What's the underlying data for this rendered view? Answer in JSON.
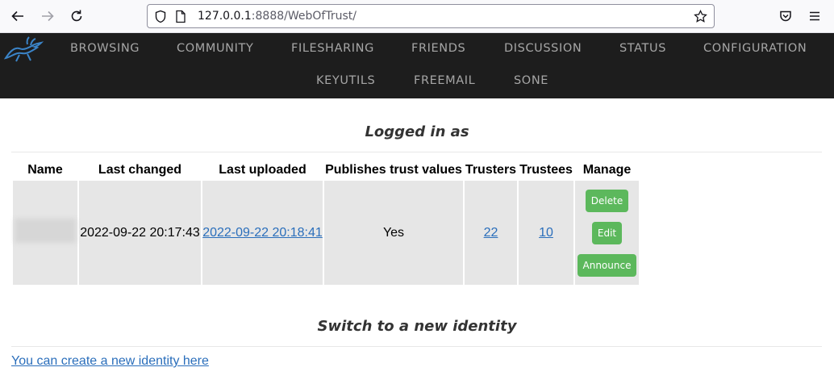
{
  "browser": {
    "url_host": "127.0.0.1",
    "url_rest": ":8888/WebOfTrust/"
  },
  "nav": {
    "items": [
      "BROWSING",
      "COMMUNITY",
      "FILESHARING",
      "FRIENDS",
      "DISCUSSION",
      "STATUS",
      "CONFIGURATION",
      "KEYUTILS",
      "FREEMAIL",
      "SONE"
    ]
  },
  "main": {
    "logged_in_heading": "Logged in as",
    "table": {
      "headers": [
        "Name",
        "Last changed",
        "Last uploaded",
        "Publishes trust values",
        "Trusters",
        "Trustees",
        "Manage"
      ],
      "row": {
        "last_changed": "2022-09-22 20:17:43",
        "last_uploaded": "2022-09-22 20:18:41",
        "publishes": "Yes",
        "trusters": "22",
        "trustees": "10"
      },
      "manage_buttons": [
        "Delete",
        "Edit",
        "Announce"
      ]
    },
    "switch_heading": "Switch to a new identity",
    "create_link": "You can create a new identity here"
  },
  "colors": {
    "nav_bg": "#1d1d1d",
    "nav_text": "#a6a6a6",
    "button_green": "#5cb85c",
    "link_blue": "#2a6ebb",
    "cell_bg": "#e6e6e6"
  }
}
